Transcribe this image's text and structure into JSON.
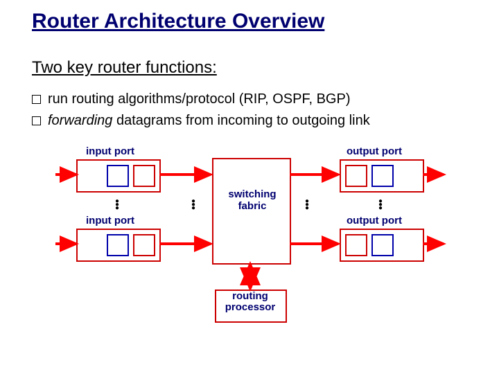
{
  "title": "Router Architecture Overview",
  "subtitle": "Two key router functions:",
  "bullets": [
    {
      "plain": "run routing algorithms/protocol (RIP, OSPF, BGP)"
    },
    {
      "italic_lead": "forwarding",
      "rest": " datagrams from incoming to outgoing link"
    }
  ],
  "diagram": {
    "input_port_label": "input port",
    "output_port_label": "output port",
    "switching_label_line1": "switching",
    "switching_label_line2": "fabric",
    "routing_processor_line1": "routing",
    "routing_processor_line2": "processor"
  },
  "colors": {
    "title": "#000070",
    "box_red": "#c00",
    "box_blue": "#00a",
    "arrow_red": "#ff0000"
  }
}
